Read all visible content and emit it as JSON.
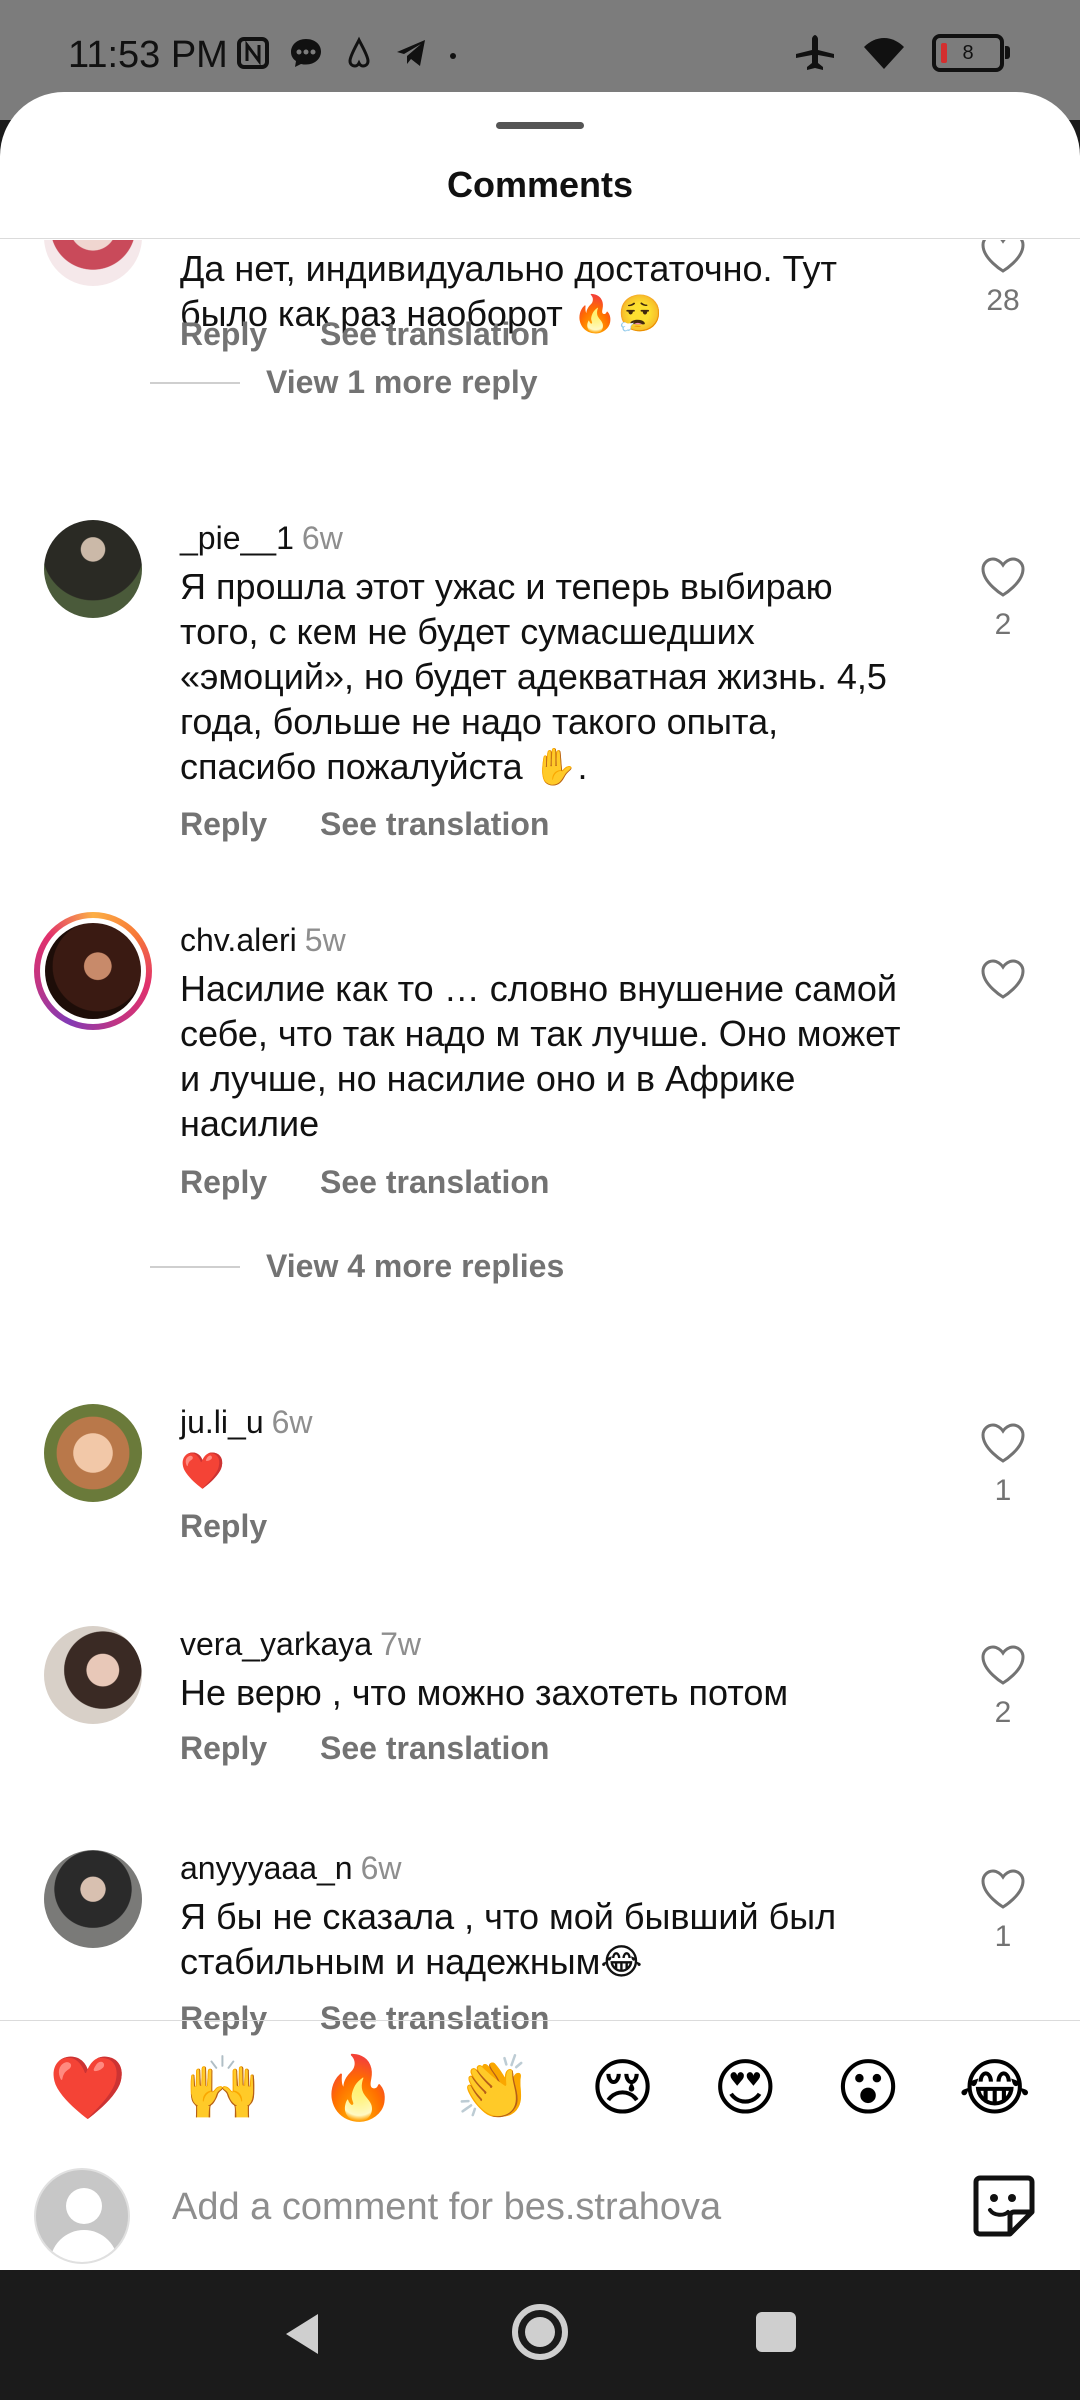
{
  "status_bar": {
    "time": "11:53 PM",
    "battery": "8"
  },
  "sheet": {
    "title": "Comments"
  },
  "top_comment": {
    "text": "Да нет, индивидуально достаточно. Тут было как раз наоборот 🔥😮‍💨",
    "likes": "28",
    "view_more": "View 1 more reply"
  },
  "comments": [
    {
      "user": "_pie__1",
      "age": "6w",
      "text": "Я прошла этот ужас и теперь выбираю того, с кем не будет сумасшедших «эмоций», но будет адекватная жизнь. 4,5 года, больше не надо такого опыта, спасибо пожалуйста ✋.",
      "likes": "2"
    },
    {
      "user": "chv.aleri",
      "age": "5w",
      "text": "Насилие как то … словно внушение самой себе, что так надо м так лучше. Оно может и лучше, но насилие оно и в Африке насилие",
      "likes": "",
      "view_more": "View 4 more replies"
    },
    {
      "user": "ju.li_u",
      "age": "6w",
      "text": "❤️",
      "likes": "1"
    },
    {
      "user": "vera_yarkaya",
      "age": "7w",
      "text": "Не верю , что можно захотеть потом",
      "likes": "2"
    },
    {
      "user": "anyyyaaa_n",
      "age": "6w",
      "text": "Я бы не сказала , что мой бывший был стабильным и надежным😂",
      "likes": "1"
    }
  ],
  "actions": {
    "reply": "Reply",
    "see_translation": "See translation"
  },
  "emoji_bar": [
    "❤️",
    "🙌",
    "🔥",
    "👏",
    "😢",
    "😍",
    "😮",
    "😂"
  ],
  "composer": {
    "placeholder": "Add a comment for bes.strahova"
  }
}
